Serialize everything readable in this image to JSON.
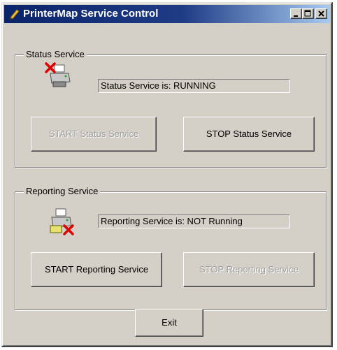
{
  "window": {
    "title": "PrinterMap Service Control"
  },
  "status_group": {
    "label": "Status Service",
    "status_text": "Status Service is:  RUNNING",
    "start_label": "START Status Service",
    "stop_label": "STOP Status Service",
    "start_enabled": false,
    "stop_enabled": true
  },
  "reporting_group": {
    "label": "Reporting Service",
    "status_text": "Reporting Service is:  NOT Running",
    "start_label": "START Reporting Service",
    "stop_label": "STOP Reporting Service",
    "start_enabled": true,
    "stop_enabled": false
  },
  "exit_label": "Exit",
  "icons": {
    "app": "printer-app-icon",
    "status_service": "printer-stopped-icon",
    "reporting_service": "printer-stopped-icon"
  },
  "colors": {
    "title_start": "#0a246a",
    "title_end": "#a6caf0",
    "face": "#d4d0c8",
    "error_x": "#e00000"
  }
}
